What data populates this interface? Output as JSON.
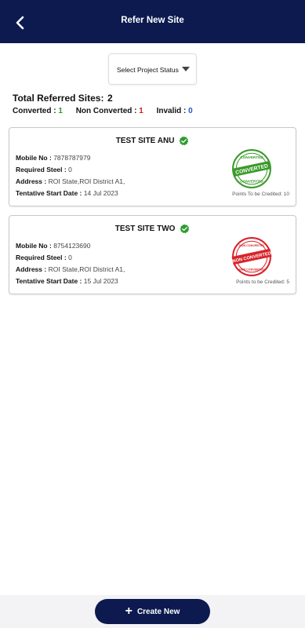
{
  "header": {
    "title": "Refer New Site",
    "back_icon": "chevron-left-icon"
  },
  "filter": {
    "selected": "Select Project Status"
  },
  "summary": {
    "total_label": "Total Referred Sites:",
    "total_value": "2",
    "converted_label": "Converted :",
    "converted_value": "1",
    "non_converted_label": "Non Converted :",
    "non_converted_value": "1",
    "invalid_label": "Invalid :",
    "invalid_value": "0"
  },
  "sites": [
    {
      "name": "TEST SITE ANU",
      "mobile_label": "Mobile No :",
      "mobile": "7878787979",
      "steel_label": "Required Steel :",
      "steel": "0",
      "address_label": "Address :",
      "address": "ROI State,ROI District A1,",
      "start_label": "Tentative Start Date :",
      "start": "14 Jul 2023",
      "stamp_text": "CONVERTED",
      "stamp_color": "#3a9a2a",
      "points": "Points To be Credited: 10"
    },
    {
      "name": "TEST SITE TWO",
      "mobile_label": "Mobile No :",
      "mobile": "8754123690",
      "steel_label": "Required Steel :",
      "steel": "0",
      "address_label": "Address :",
      "address": "ROI State,ROI District A1,",
      "start_label": "Tentative Start Date :",
      "start": "15 Jul 2023",
      "stamp_text": "NON CONVERTED",
      "stamp_color": "#d8232a",
      "points": "Points to be Credited: 5"
    }
  ],
  "footer": {
    "create_label": "Create New"
  },
  "colors": {
    "primary": "#0c1a4f",
    "verified": "#2e9a2e",
    "converted": "#2e9a2e",
    "non_converted": "#d32020",
    "invalid": "#1f56c8"
  }
}
